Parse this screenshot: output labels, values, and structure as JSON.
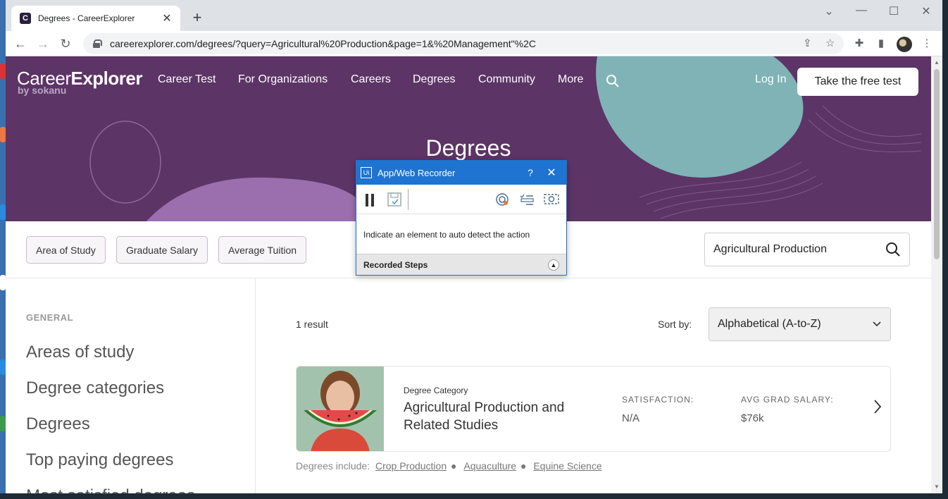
{
  "browser": {
    "tab_title": "Degrees - CareerExplorer",
    "url": "careerexplorer.com/degrees/?query=Agricultural%20Production&page=1&%20Management\"%2C"
  },
  "site": {
    "logo_main": "CareerExplorer",
    "logo_sub": "by sokanu",
    "nav": [
      "Career Test",
      "For Organizations",
      "Careers",
      "Degrees",
      "Community",
      "More"
    ],
    "login": "Log In",
    "cta": "Take the free test",
    "hero_title": "Degrees",
    "colors": {
      "hero": "#5d3466",
      "teal_blob": "#7fb3b6",
      "lilac_blob": "#9b6fae"
    }
  },
  "filters": {
    "chips": [
      "Area of Study",
      "Graduate Salary",
      "Average Tuition"
    ],
    "search_value": "Agricultural Production"
  },
  "sidebar": {
    "heading": "GENERAL",
    "items": [
      "Areas of study",
      "Degree categories",
      "Degrees",
      "Top paying degrees",
      "Most satisfied degrees"
    ]
  },
  "results": {
    "count": "1 result",
    "sort_label": "Sort by:",
    "sort_value": "Alphabetical (A-to-Z)",
    "card": {
      "category": "Degree Category",
      "title": "Agricultural Production and Related Studies",
      "satisfaction_label": "SATISFACTION:",
      "satisfaction_value": "N/A",
      "salary_label": "AVG GRAD SALARY:",
      "salary_value": "$76k"
    },
    "includes_label": "Degrees include:",
    "includes": [
      "Crop Production",
      "Aquaculture",
      "Equine Science"
    ]
  },
  "recorder": {
    "title": "App/Web Recorder",
    "help": "?",
    "message": "Indicate an element to auto detect the action",
    "steps_label": "Recorded Steps"
  }
}
